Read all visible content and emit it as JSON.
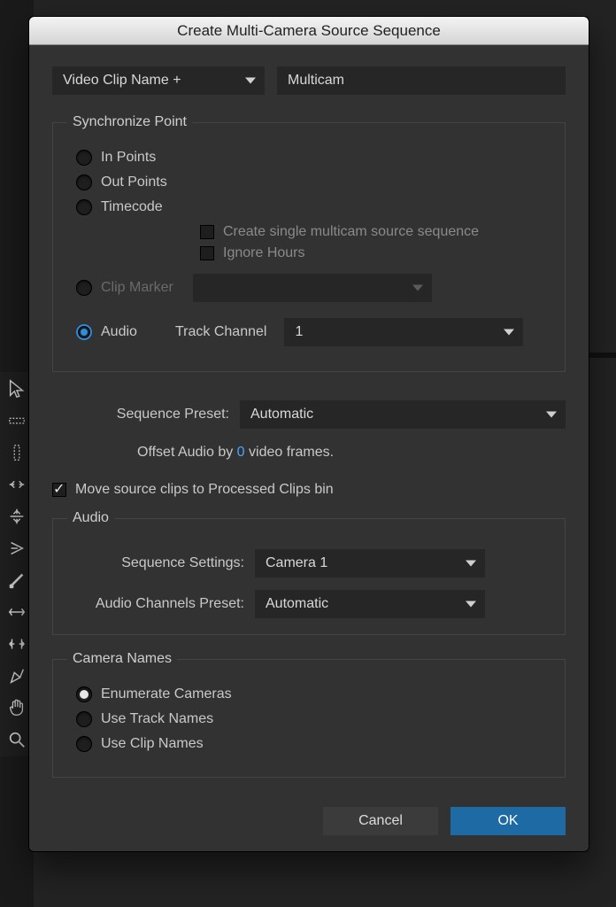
{
  "dialog": {
    "title": "Create Multi-Camera Source Sequence",
    "name_mode": "Video Clip Name +",
    "name_value": "Multicam",
    "sync": {
      "legend": "Synchronize Point",
      "in_points": "In Points",
      "out_points": "Out Points",
      "timecode": "Timecode",
      "tc_single": "Create single multicam source sequence",
      "tc_ignore": "Ignore Hours",
      "clip_marker": "Clip Marker",
      "clip_marker_value": "",
      "audio": "Audio",
      "track_channel_label": "Track Channel",
      "track_channel_value": "1"
    },
    "seq_preset_label": "Sequence Preset:",
    "seq_preset_value": "Automatic",
    "offset_prefix": "Offset Audio by",
    "offset_value": "0",
    "offset_suffix": "video frames.",
    "move_bin": "Move source clips to Processed Clips bin",
    "audio_group": {
      "legend": "Audio",
      "seq_settings_label": "Sequence Settings:",
      "seq_settings_value": "Camera 1",
      "ch_preset_label": "Audio Channels Preset:",
      "ch_preset_value": "Automatic"
    },
    "camnames": {
      "legend": "Camera Names",
      "enum": "Enumerate Cameras",
      "tracks": "Use Track Names",
      "clips": "Use Clip Names"
    },
    "cancel": "Cancel",
    "ok": "OK"
  }
}
